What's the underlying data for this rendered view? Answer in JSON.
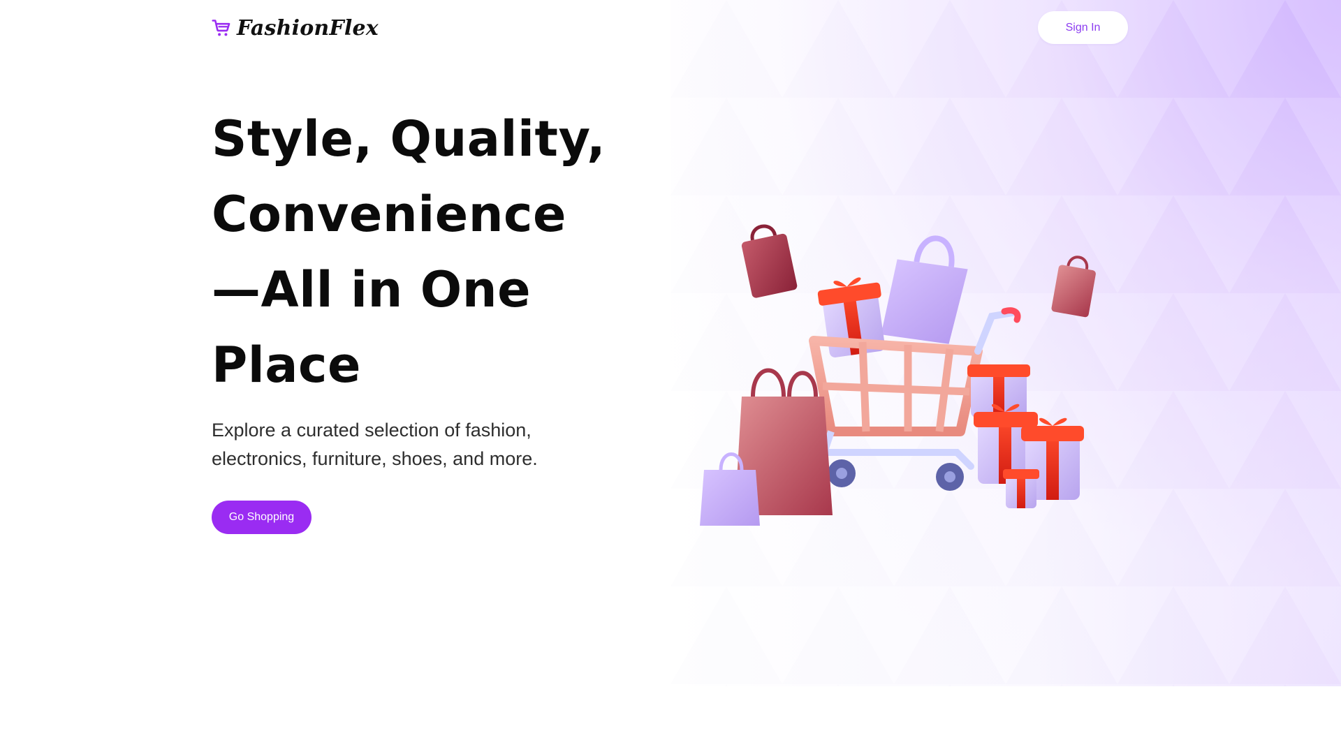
{
  "brand": {
    "name": "FashionFlex",
    "logo_icon": "shopping-cart-icon",
    "accent_color": "#9a2cf2"
  },
  "header": {
    "signin_label": "Sign In"
  },
  "hero": {
    "headline_lines": [
      "Style, Quality,",
      "Convenience",
      "—All in One",
      "Place"
    ],
    "subtext_lines": [
      "Explore a curated selection of fashion,",
      "electronics, furniture, shoes, and more."
    ],
    "cta_label": "Go Shopping",
    "illustration": "shopping-cart-with-bags-and-gifts-illustration"
  }
}
